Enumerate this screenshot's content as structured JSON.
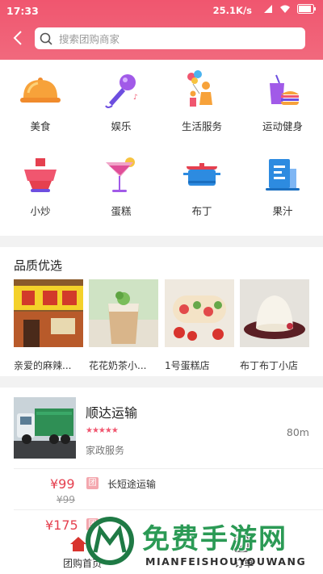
{
  "status_bar": {
    "time": "17:33",
    "network_speed": "25.1K/s",
    "battery_icon": "battery-icon"
  },
  "search": {
    "placeholder": "搜索团购商家"
  },
  "categories": [
    {
      "label": "美食",
      "icon": "food-cloche-icon"
    },
    {
      "label": "娱乐",
      "icon": "microphone-icon"
    },
    {
      "label": "生活服务",
      "icon": "family-balloons-icon"
    },
    {
      "label": "运动健身",
      "icon": "drink-burger-icon"
    },
    {
      "label": "小炒",
      "icon": "hotpot-icon"
    },
    {
      "label": "蛋糕",
      "icon": "cocktail-icon"
    },
    {
      "label": "布丁",
      "icon": "pot-icon"
    },
    {
      "label": "果汁",
      "icon": "building-icon"
    }
  ],
  "quality": {
    "title": "品质优选",
    "items": [
      {
        "name": "亲爱的麻辣..."
      },
      {
        "name": "花花奶茶小..."
      },
      {
        "name": "1号蛋糕店"
      },
      {
        "name": "布丁布丁小店"
      }
    ]
  },
  "shop": {
    "name": "顺达运输",
    "rating": 5,
    "distance": "80m",
    "category": "家政服务",
    "deals": [
      {
        "price": "¥99",
        "original": "¥99",
        "badge": "团",
        "name": "长短途运输"
      },
      {
        "price": "¥175",
        "original": "",
        "badge": "团",
        "name": ""
      }
    ]
  },
  "bottom_nav": [
    {
      "label": "团购首页",
      "icon": "home-icon"
    },
    {
      "label": "订单",
      "icon": "order-icon"
    }
  ],
  "watermark": {
    "title": "免费手游网",
    "subtitle": "MIANFEISHOUYOUWANG"
  },
  "colors": {
    "brand": "#f0566f",
    "price": "#e5404f"
  }
}
